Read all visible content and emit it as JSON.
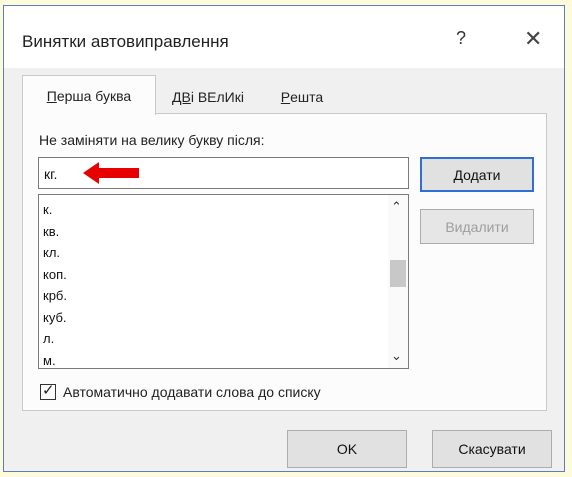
{
  "dialog": {
    "title": "Винятки автовиправлення",
    "help": "?",
    "close": "✕"
  },
  "tabs": [
    {
      "label_pre": "",
      "label_u": "П",
      "label_post": "ерша буква",
      "active": true
    },
    {
      "label_pre": "",
      "label_u": "ДВ",
      "label_post": "і ВЕлИкі",
      "active": false
    },
    {
      "label_pre": "",
      "label_u": "Р",
      "label_post": "ешта",
      "active": false
    }
  ],
  "panel": {
    "label": "Не заміняти на велику букву після:",
    "input_value": "кг.",
    "items": [
      "к.",
      "кв.",
      "кл.",
      "коп.",
      "крб.",
      "куб.",
      "л.",
      "м."
    ],
    "add_button": "Додати",
    "delete_button": "Видалити",
    "auto_add_label": "Автоматично додавати слова до списку",
    "auto_add_checked": true
  },
  "footer": {
    "ok": "OK",
    "cancel": "Скасувати"
  },
  "colors": {
    "accent": "#2f6fd1",
    "arrow": "#e60000",
    "background": "#fdfbd9"
  }
}
